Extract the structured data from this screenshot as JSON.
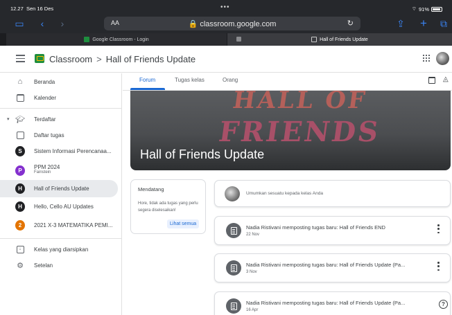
{
  "status": {
    "time": "12.27",
    "date": "Sen 16 Des",
    "battery_text": "91%",
    "battery_level": 0.91
  },
  "browser": {
    "text_size_label": "AA",
    "url": "classroom.google.com",
    "tabs": [
      {
        "label": "Google Classroom - Login",
        "active": false
      },
      {
        "label": "Hall of Friends Update",
        "active": true
      }
    ]
  },
  "header": {
    "app_name": "Classroom",
    "separator": ">",
    "class_name": "Hall of Friends Update"
  },
  "sidebar": {
    "items": [
      {
        "label": "Beranda",
        "icon": "home-icon"
      },
      {
        "label": "Kalender",
        "icon": "calendar-icon"
      },
      {
        "label": "Terdaftar",
        "icon": "enrolled-icon"
      },
      {
        "label": "Daftar tugas",
        "icon": "todo-icon"
      },
      {
        "label": "Sistem Informasi Perencanaa...",
        "initial": "S",
        "color": "#202124"
      },
      {
        "label": "PPM 2024",
        "sublabel": "Fainstein",
        "initial": "P",
        "color": "#8430ce"
      },
      {
        "label": "Hall of Friends Update",
        "initial": "H",
        "color": "#202124"
      },
      {
        "label": "Hello, Cello AU Updates",
        "initial": "H",
        "color": "#202124"
      },
      {
        "label": "2021 X-3 MATEMATIKA PEMI...",
        "initial": "2",
        "color": "#e37400"
      },
      {
        "label": "Kelas yang diarsipkan",
        "icon": "archive-icon"
      },
      {
        "label": "Setelan",
        "icon": "settings-icon"
      }
    ]
  },
  "nav_tabs": [
    "Forum",
    "Tugas kelas",
    "Orang"
  ],
  "banner": {
    "title": "Hall of Friends Update",
    "image_words": [
      "HALL OF",
      "FRIENDS"
    ]
  },
  "upcoming": {
    "heading": "Mendatang",
    "text": "Hore, tidak ada tugas yang perlu segera diselesaikan!",
    "button": "Lihat semua"
  },
  "announce": {
    "placeholder": "Umumkan sesuatu kepada kelas Anda"
  },
  "posts": [
    {
      "title": "Nadia Ristivani memposting tugas baru: Hall of Friends END",
      "date": "22 Nov"
    },
    {
      "title": "Nadia Ristivani memposting tugas baru: Hall of Friends Update (Pa...",
      "date": "3 Nov"
    },
    {
      "title": "Nadia Ristivani memposting tugas baru: Hall of Friends Update (Pa...",
      "date": "16 Apr"
    }
  ],
  "help_symbol": "?"
}
